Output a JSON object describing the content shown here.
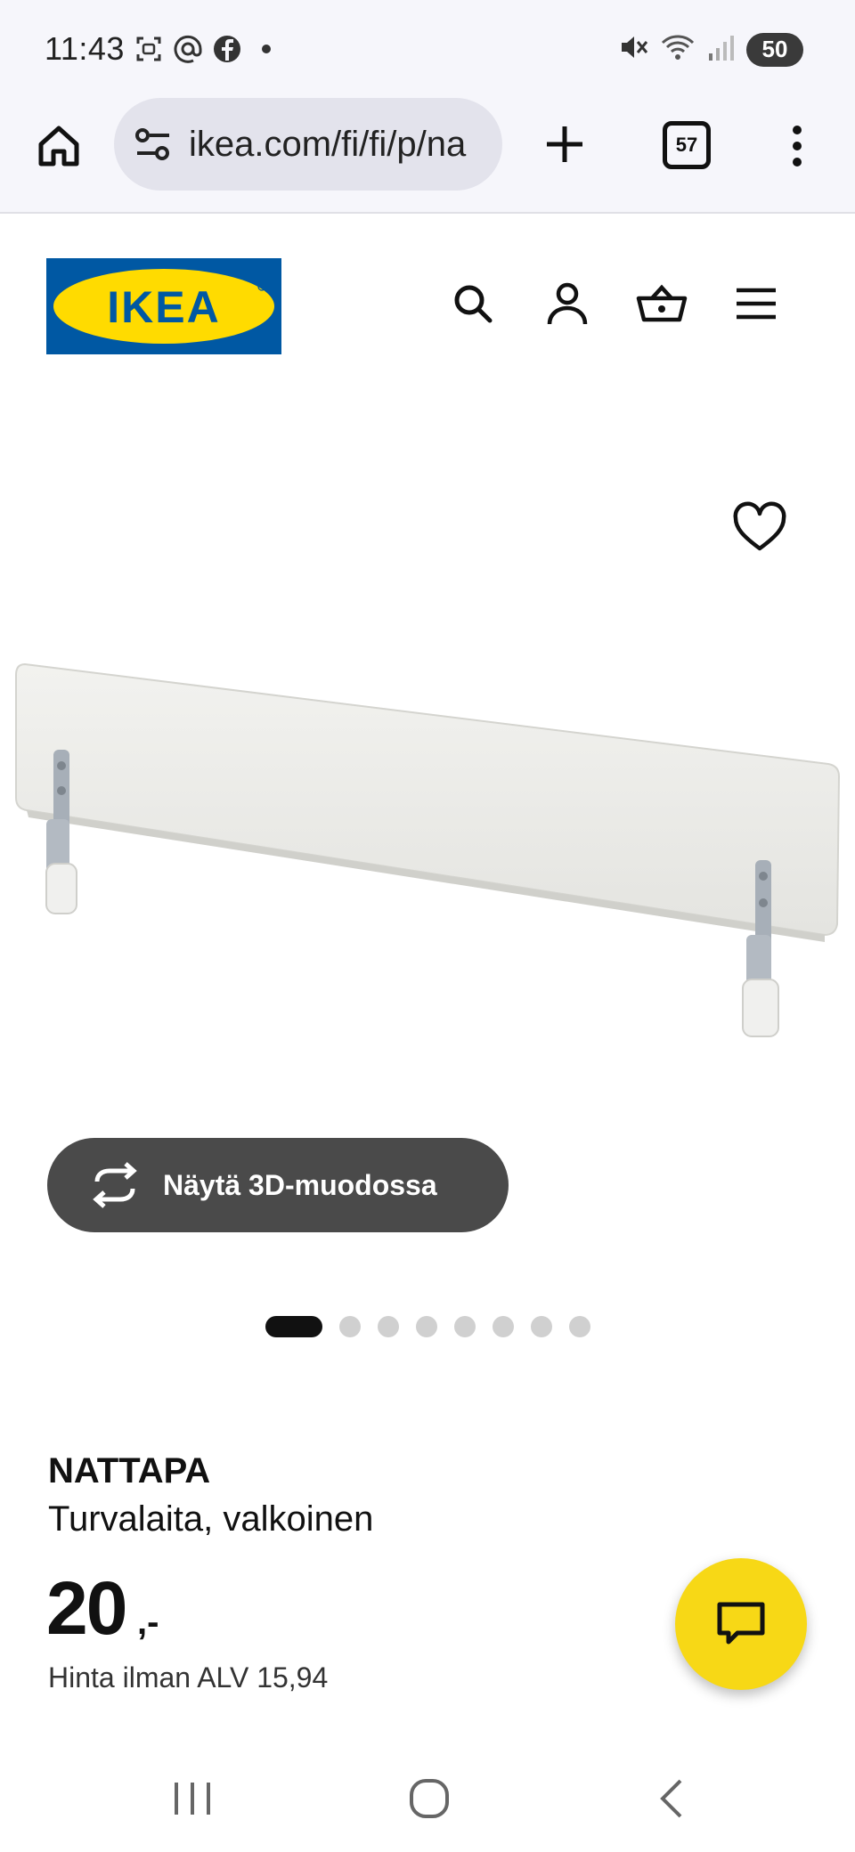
{
  "status_bar": {
    "time": "11:43",
    "battery": "50",
    "left_icons": [
      "screenshot-icon",
      "at-icon",
      "facebook-icon",
      "dot-icon"
    ],
    "right_icons": [
      "mute-icon",
      "wifi-icon",
      "signal-icon"
    ]
  },
  "browser": {
    "url": "ikea.com/fi/fi/p/na",
    "tab_count": "57"
  },
  "header": {
    "logo_text": "IKEA",
    "icons": [
      "search-icon",
      "account-icon",
      "basket-icon",
      "menu-icon"
    ]
  },
  "gallery": {
    "view_3d_label": "Näytä 3D-muodossa",
    "dots_total": 8,
    "dots_active": 1
  },
  "product": {
    "name": "NATTAPA",
    "description": "Turvalaita, valkoinen",
    "price": "20",
    "price_suffix": ",-",
    "vat_text": "Hinta ilman ALV 15,94"
  },
  "colors": {
    "ikea_blue": "#0058a3",
    "ikea_yellow": "#ffdb00",
    "chat_yellow": "#f7d816",
    "dark_button": "#4a4a4a"
  }
}
